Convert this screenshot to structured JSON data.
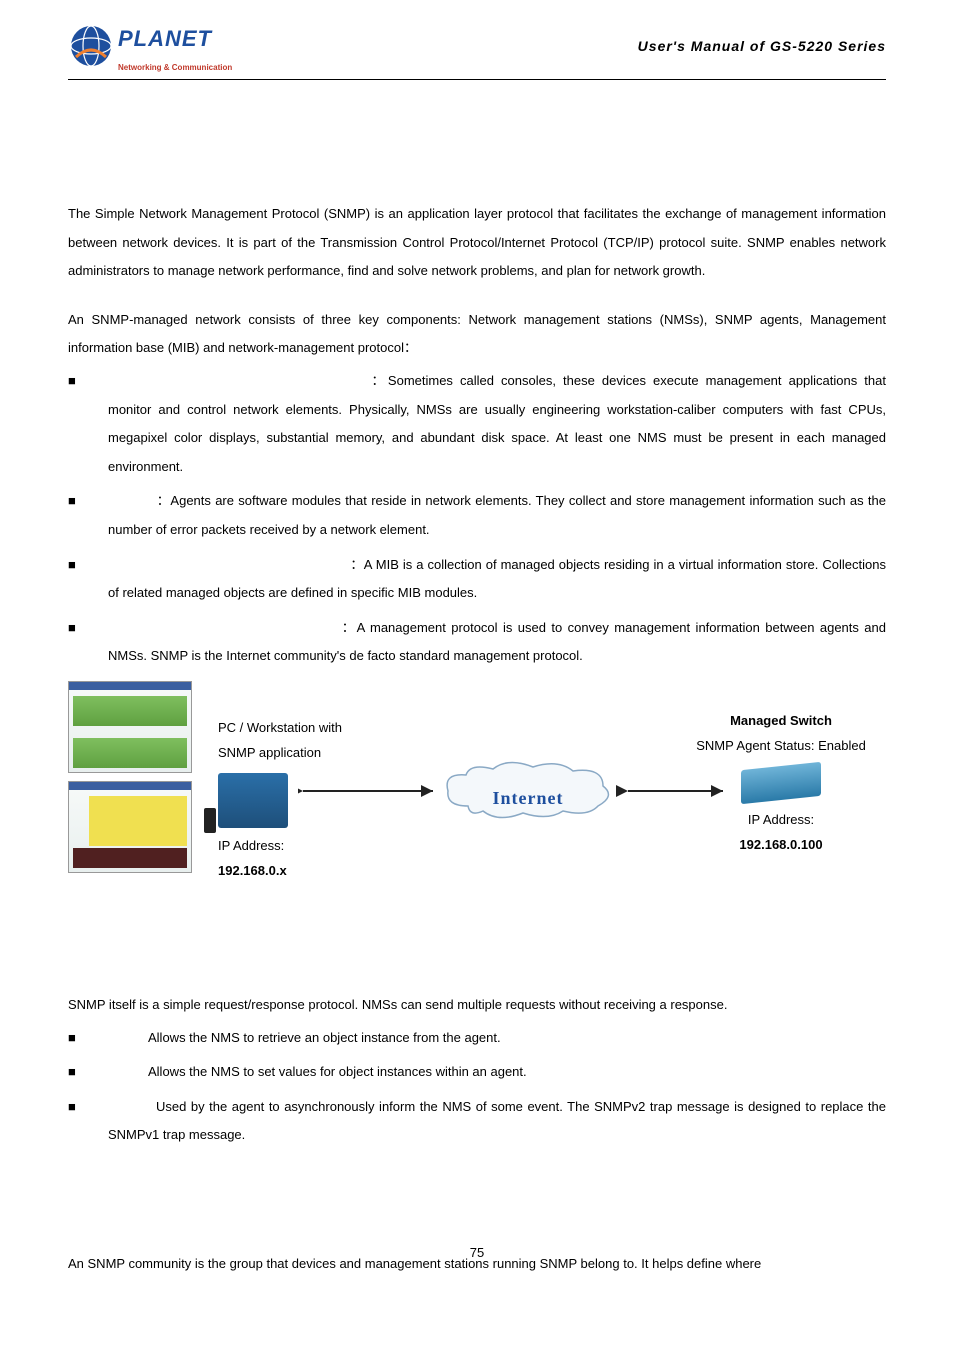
{
  "header": {
    "brand_main": "PLANET",
    "brand_tag": "Networking & Communication",
    "manual_title": "User's Manual of GS-5220 Series"
  },
  "intro_para": "The Simple Network Management Protocol (SNMP) is an application layer protocol that facilitates the exchange of management information between network devices. It is part of the Transmission Control Protocol/Internet Protocol (TCP/IP) protocol suite. SNMP enables network administrators to manage network performance, find and solve network problems, and plan for network growth.",
  "components_para": "An SNMP-managed network consists of three key components: Network management stations (NMSs), SNMP agents, Management information base (MIB) and network-management protocol：",
  "components": [
    {
      "text": "：Sometimes called consoles, these devices execute management applications that monitor and control network elements. Physically, NMSs are usually engineering workstation-caliber computers with fast CPUs, megapixel color displays, substantial memory, and abundant disk space. At least one NMS must be present in each managed environment."
    },
    {
      "text": "：Agents are software modules that reside in network elements. They collect and store management information such as the number of error packets received by a network element."
    },
    {
      "text": "：A MIB is a collection of managed objects residing in a virtual information store. Collections of related managed objects are defined in specific MIB modules."
    },
    {
      "text": "：A management protocol is used to convey management information between agents and NMSs. SNMP is the Internet community's de facto standard management protocol."
    }
  ],
  "diagram": {
    "pc_title": "PC / Workstation with",
    "pc_sub": "SNMP application",
    "pc_ip_label": "IP Address:",
    "pc_ip_value": "192.168.0.x",
    "internet": "Internet",
    "switch_title": "Managed Switch",
    "switch_sub": "SNMP Agent Status: Enabled",
    "switch_ip_label": "IP Address:",
    "switch_ip_value": "192.168.0.100"
  },
  "protocol_para": "SNMP itself is a simple request/response protocol. NMSs can send multiple requests without receiving a response.",
  "operations": [
    {
      "desc": "Allows the NMS to retrieve an object instance from the agent."
    },
    {
      "desc": "Allows the NMS to set values for object instances within an agent."
    },
    {
      "desc": "Used by the agent to asynchronously inform the NMS of some event. The SNMPv2 trap message is designed to replace the SNMPv1 trap message."
    }
  ],
  "community_para": "An SNMP community is the group that devices and management stations running SNMP belong to. It helps define where",
  "page_number": "75"
}
